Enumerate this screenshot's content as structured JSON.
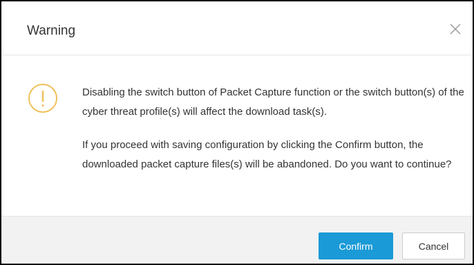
{
  "dialog": {
    "title": "Warning",
    "close_icon": "close-icon",
    "warning_icon": "warning-icon",
    "warning_icon_color": "#f0c05a",
    "message": {
      "paragraph_1": "Disabling the switch button of Packet Capture function or the switch button(s) of the cyber threat profile(s) will affect the download task(s).",
      "paragraph_2": "If you proceed with saving configuration by clicking the Confirm button, the downloaded packet capture files(s) will be abandoned. Do you want to continue?"
    },
    "buttons": {
      "confirm_label": "Confirm",
      "cancel_label": "Cancel"
    },
    "colors": {
      "confirm_bg": "#1a9ad6",
      "footer_bg": "#f2f2f2"
    }
  }
}
